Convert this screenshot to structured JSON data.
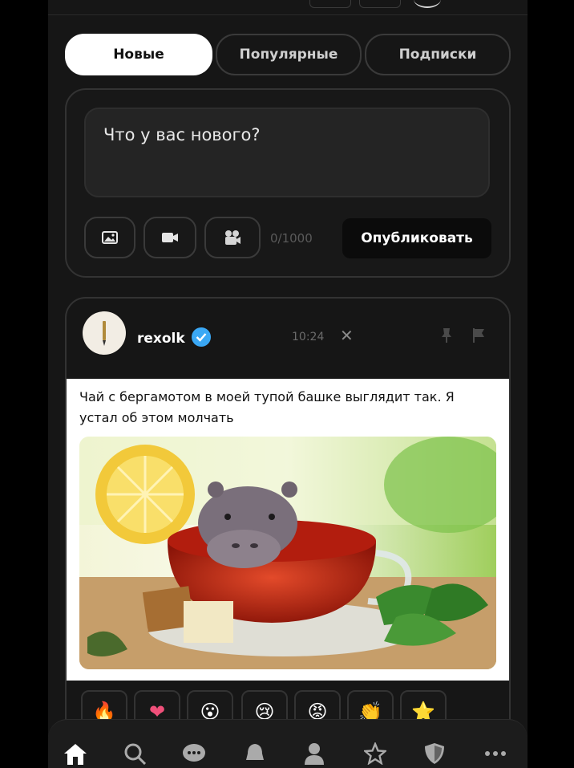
{
  "tabs": [
    {
      "label": "Новые",
      "active": true
    },
    {
      "label": "Популярные",
      "active": false
    },
    {
      "label": "Подписки",
      "active": false
    }
  ],
  "composer": {
    "placeholder": "Что у вас нового?",
    "counter": "0/1000",
    "publish_label": "Опубликовать",
    "tools": [
      "image-icon",
      "video-icon",
      "gif-icon"
    ]
  },
  "post": {
    "username": "rexolk",
    "verified": true,
    "time": "10:24",
    "text": "Чай с бергамотом в моей тупой башке выглядит так. Я устал об этом молчать",
    "reactions": [
      "🔥",
      "❤",
      "😮",
      "😢",
      "😡",
      "👏",
      "⭐"
    ]
  },
  "nav": [
    "home-icon",
    "search-icon",
    "messages-icon",
    "bell-icon",
    "profile-icon",
    "star-icon",
    "shield-icon",
    "more-icon"
  ],
  "colors": {
    "accent": "#3aa8f5",
    "background": "#161616"
  }
}
